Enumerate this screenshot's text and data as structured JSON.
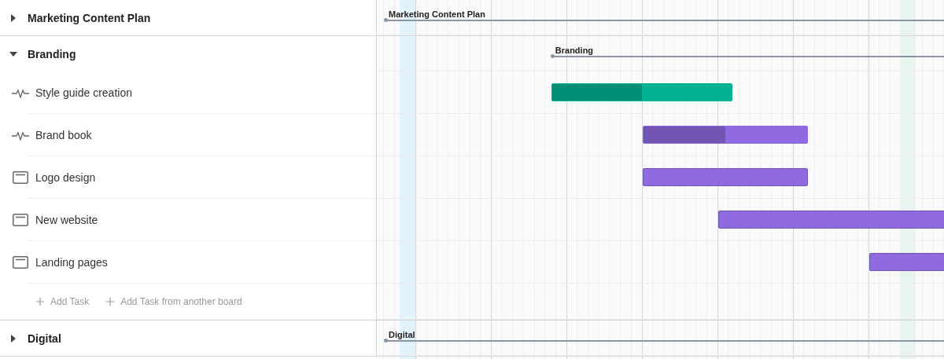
{
  "groups": [
    {
      "name": "Marketing Content Plan",
      "expanded": false,
      "summary": {
        "label": "Marketing Content Plan"
      }
    },
    {
      "name": "Branding",
      "expanded": true,
      "summary": {
        "label": "Branding"
      },
      "tasks": [
        {
          "name": "Style guide creation",
          "kind": "activity",
          "level": 0.5,
          "color": "#00b192"
        },
        {
          "name": "Brand book",
          "kind": "activity",
          "level": 0.5,
          "color": "#8f6ae0"
        },
        {
          "name": "Logo design",
          "kind": "card",
          "color": "#8f6ae0"
        },
        {
          "name": "New website",
          "kind": "card",
          "color": "#8f6ae0"
        },
        {
          "name": "Landing pages",
          "kind": "card",
          "color": "#8f6ae0"
        }
      ],
      "add_actions": [
        {
          "label": "Add Task"
        },
        {
          "label": "Add Task from another board"
        }
      ]
    },
    {
      "name": "Digital",
      "expanded": false,
      "summary": {
        "label": "Digital"
      }
    }
  ]
}
